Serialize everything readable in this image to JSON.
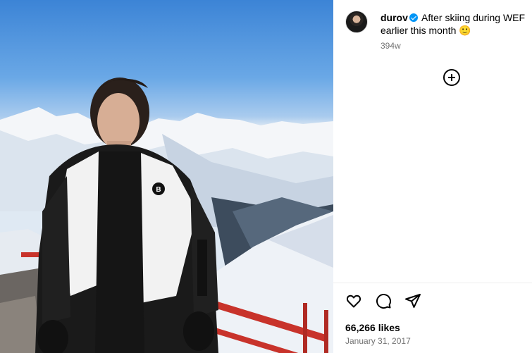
{
  "post": {
    "username": "durov",
    "verified": true,
    "caption_text": "After skiing during WEF earlier this month 🙂",
    "time_ago": "394w",
    "likes": "66,266 likes",
    "date": "January 31, 2017"
  },
  "photo": {
    "jacket_brand": "BOGNER",
    "description": "man in ski jacket in front of snowy mountains"
  },
  "icons": {
    "verified": "verified-badge-icon",
    "add_comment": "plus-circle-icon",
    "like": "heart-icon",
    "comment": "comment-bubble-icon",
    "share": "paper-plane-icon"
  },
  "colors": {
    "verified_blue": "#0095f6",
    "secondary_text": "#737373",
    "divider": "#efefef"
  }
}
